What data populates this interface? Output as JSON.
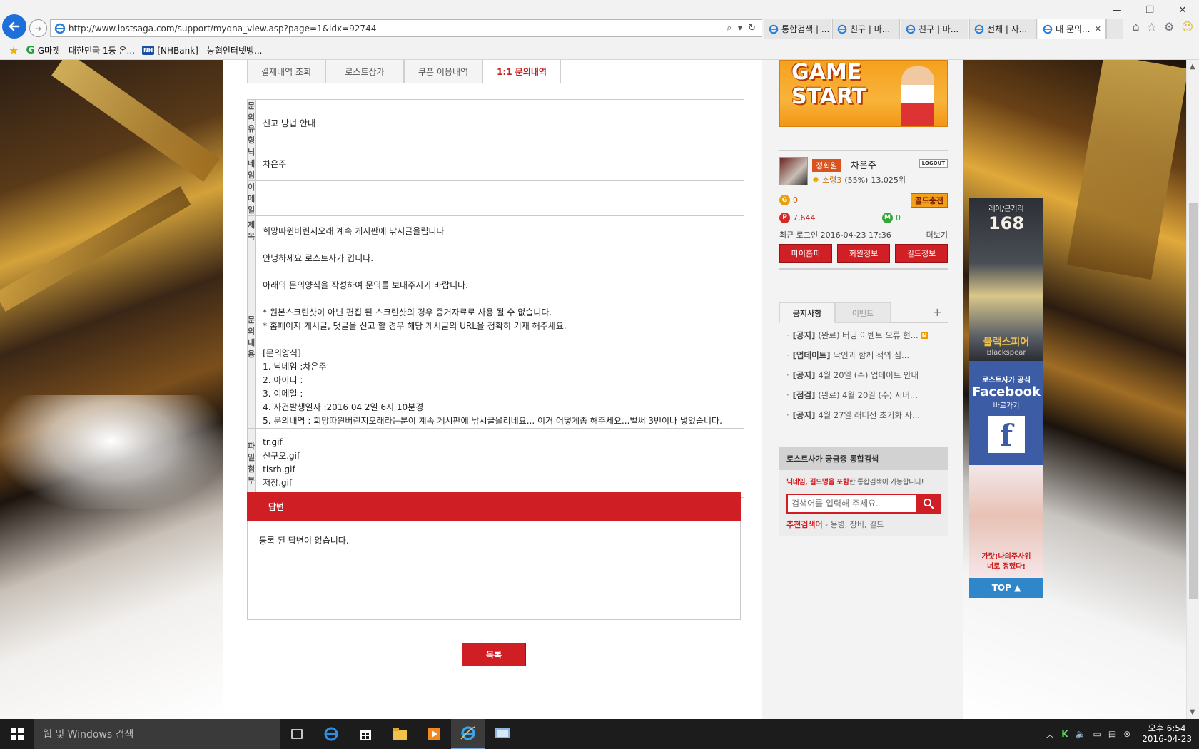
{
  "browser": {
    "url": "http://www.lostsaga.com/support/myqna_view.asp?page=1&idx=92744",
    "tabs": [
      {
        "label": "통합검색 | ...",
        "active": false
      },
      {
        "label": "친구 | 마...",
        "active": false
      },
      {
        "label": "친구 | 마...",
        "active": false
      },
      {
        "label": "전체 | 자...",
        "active": false
      },
      {
        "label": "내 문의...",
        "active": true
      }
    ],
    "favorites": [
      {
        "label": "G마켓 - 대한민국 1등 온...",
        "icon": "gmarket-icon"
      },
      {
        "label": "[NHBank] - 농협인터넷뱅...",
        "icon": "nhbank-icon"
      }
    ],
    "nh_logo_text": "NH",
    "g_logo_text": "G"
  },
  "content_tabs": [
    {
      "label": "결제내역 조회",
      "active": false
    },
    {
      "label": "로스트상가",
      "active": false
    },
    {
      "label": "쿠폰 이용내역",
      "active": false
    },
    {
      "label": "1:1 문의내역",
      "active": true
    }
  ],
  "inquiry": {
    "type_label": "문의유형",
    "type_value": "신고 방법 안내",
    "nickname_label": "닉네임",
    "nickname_value": "차은주",
    "email_label": "이메일",
    "email_value": "",
    "subject_label": "제목",
    "subject_value": "희망따윈버린지오래 계속 게시판에 낚시글올립니다",
    "content_label": "문의내용",
    "content_lines": [
      "안녕하세요 로스트사가 입니다.",
      "",
      "아래의 문의양식을 작성하여 문의를 보내주시기 바랍니다.",
      "",
      "* 원본스크린샷이 아닌 편집 된 스크린샷의 경우 증거자료로 사용 될 수 없습니다.",
      "* 홈페이지 게시글, 댓글을 신고 할 경우 해당 게시글의 URL을 정확히 기재 해주세요.",
      "",
      " [문의양식]",
      "1. 닉네임 :차은주",
      "2. 아이디 :",
      "3. 이메일 :",
      "4. 사건발생일자 :2016 04 2일 6시 10분경",
      "5. 문의내역 : 희망따윈버린지오래라는분이 계속 게시판에 낚시글올리네요... 이거 어떻게좀 해주세요...벌써 3번이나 넣었습니다."
    ],
    "files_label": "파일첨부",
    "files": [
      "tr.gif",
      "신구오.gif",
      "tlsrh.gif",
      "저장.gif"
    ]
  },
  "answer": {
    "title": "답변",
    "body": "등록 된 답변이 없습니다."
  },
  "list_button": "목록",
  "sidebar": {
    "game_start": "GAME START",
    "member_badge": "정회원",
    "nickname": "차은주",
    "logout": "LOGOUT",
    "rank": "소령3",
    "rank_pct": "(55%)",
    "rank_num": "13,025위",
    "gold_coin": "G",
    "gold_value": "0",
    "gold_charge": "골드충전",
    "p_coin": "P",
    "p_value": "7,644",
    "m_coin": "M",
    "m_value": "0",
    "last_login": "최근 로그인 2016-04-23 17:36",
    "more": "더보기",
    "buttons": [
      "마이홈피",
      "회원정보",
      "길드정보"
    ],
    "notice_tabs": [
      "공지사항",
      "이벤트"
    ],
    "notice_plus": "+",
    "notices": [
      {
        "tag": "[공지]",
        "text": "(완료) 버닝 이벤트 오류 현...",
        "new": true
      },
      {
        "tag": "[업데이트]",
        "text": "낙인과 함께 적의 심...",
        "new": false
      },
      {
        "tag": "[공지]",
        "text": "4월 20일 (수) 업데이트 안내",
        "new": false
      },
      {
        "tag": "[점검]",
        "text": "(완료) 4월 20일 (수) 서버...",
        "new": false
      },
      {
        "tag": "[공지]",
        "text": "4월 27일 래더전 초기화 사...",
        "new": false
      }
    ],
    "new_badge": "N",
    "search_title": "로스트사가 궁금증 통합검색",
    "search_note_bold": "닉네임, 길드명을 포함",
    "search_note_rest": "한 통합검색이 가능합니다!",
    "search_placeholder": "검색어를 입력해 주세요.",
    "rec_label": "추천검색어",
    "rec_terms": "- 용병, 장비, 길드"
  },
  "banners": {
    "b1_top": "레어/근거리",
    "b1_num": "168",
    "b1_name": "블랙스피어",
    "b1_eng": "Blackspear",
    "b2_t1": "로스트사가 공식",
    "b2_t2": "Facebook",
    "b2_t3": "바로가기",
    "fb": "f",
    "b3_l1": "가랏!나의주사위",
    "b3_l2": "너로 정했다!",
    "b4": "TOP ▲"
  },
  "taskbar": {
    "search_placeholder": "웹 및 Windows 검색",
    "time_ampm": "오후 6:54",
    "date": "2016-04-23"
  },
  "colors": {
    "accent_red": "#d01f24",
    "ie_blue": "#1e6fd9"
  }
}
